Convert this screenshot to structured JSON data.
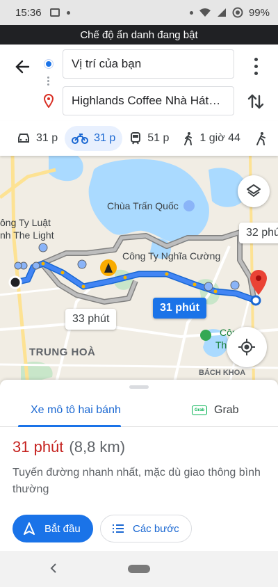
{
  "status_bar": {
    "time": "15:36",
    "battery": "99%"
  },
  "incognito_banner": "Chế độ ẩn danh đang bật",
  "route": {
    "origin": "Vị trí của bạn",
    "destination": "Highlands Coffee Nhà Hát…"
  },
  "modes": [
    {
      "icon": "car-icon",
      "label": "31 p"
    },
    {
      "icon": "motorbike-icon",
      "label": "31 p",
      "selected": true
    },
    {
      "icon": "transit-icon",
      "label": "51 p"
    },
    {
      "icon": "walk-icon",
      "label": "1 giờ 44"
    },
    {
      "icon": "bike-icon",
      "label": ""
    }
  ],
  "map": {
    "labels": {
      "pagoda": "Chùa Trấn Quốc",
      "company_left_1": "ông Ty Luật",
      "company_left_2": "nh The Light",
      "company_mid": "Công Ty Nghĩa Cường",
      "district": "TRUNG HOÀ",
      "bach_khoa": "BÁCH KHOA",
      "cong_right_1": "Công",
      "cong_right_2": "Th"
    },
    "durations": {
      "selected": "31 phút",
      "alt_left": "33 phút",
      "alt_right": "32 phú"
    }
  },
  "sheet": {
    "tab_bike": "Xe mô tô hai bánh",
    "tab_grab": "Grab",
    "grab_logo": "Grab",
    "duration": "31 phút",
    "distance": "(8,8 km)",
    "note": "Tuyến đường nhanh nhất, mặc dù giao thông bình thường",
    "start_label": "Bắt đầu",
    "steps_label": "Các bước"
  },
  "colors": {
    "accent": "#1a73e8",
    "route_main": "#4285f4",
    "route_alt": "#9e9e9e",
    "duration_red": "#c5221f",
    "incognito_bg": "#202124"
  }
}
